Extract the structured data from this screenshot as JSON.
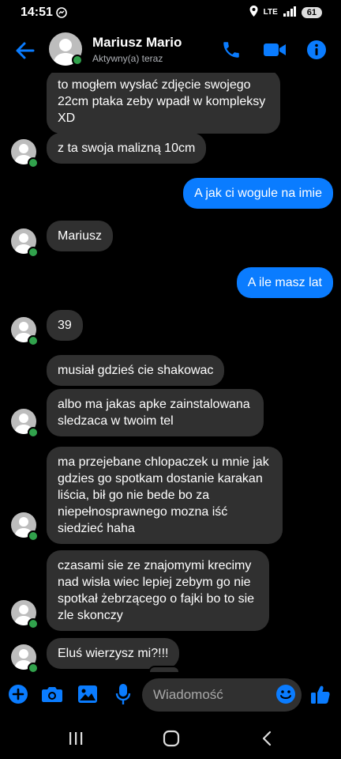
{
  "status_bar": {
    "time": "14:51",
    "network": "LTE",
    "battery": "61"
  },
  "header": {
    "name": "Mariusz Mario",
    "status": "Aktywny(a) teraz"
  },
  "messages": [
    {
      "from": "them",
      "text": "to mogłem wysłać zdjęcie swojego 22cm ptaka zeby wpadł w kompleksy XD"
    },
    {
      "from": "them",
      "text": "z ta swoja malizną 10cm"
    },
    {
      "from": "me",
      "text": "A jak ci wogule na imie"
    },
    {
      "from": "them",
      "text": "Mariusz"
    },
    {
      "from": "me",
      "text": "A ile masz lat"
    },
    {
      "from": "them",
      "text": "39"
    },
    {
      "from": "them",
      "text": "musiał gdzieś cie shakowac"
    },
    {
      "from": "them",
      "text": "albo ma jakas apke zainstalowana sledzaca w twoim tel"
    },
    {
      "from": "them",
      "text": "ma przejebane chlopaczek u mnie jak gdzies go spotkam dostanie karakan liścia, bił go nie bede bo za niepełnosprawnego mozna iść siedzieć haha"
    },
    {
      "from": "them",
      "text": "czasami sie ze znajomymi krecimy nad wisła wiec lepiej zebym go nie spotkał żebrzącego o fajki bo to sie zle skonczy"
    },
    {
      "from": "them",
      "text": "Eluś wierzysz mi?!!!"
    }
  ],
  "composer": {
    "placeholder": "Wiadomość"
  },
  "colors": {
    "accent": "#0a7cff",
    "incoming_bubble": "#303030",
    "online": "#31a24c"
  },
  "icons": [
    "back-arrow-icon",
    "phone-icon",
    "video-camera-icon",
    "info-icon",
    "plus-icon",
    "camera-icon",
    "image-icon",
    "microphone-icon",
    "emoji-icon",
    "thumbs-up-icon",
    "recents-icon",
    "home-icon",
    "back-icon"
  ]
}
